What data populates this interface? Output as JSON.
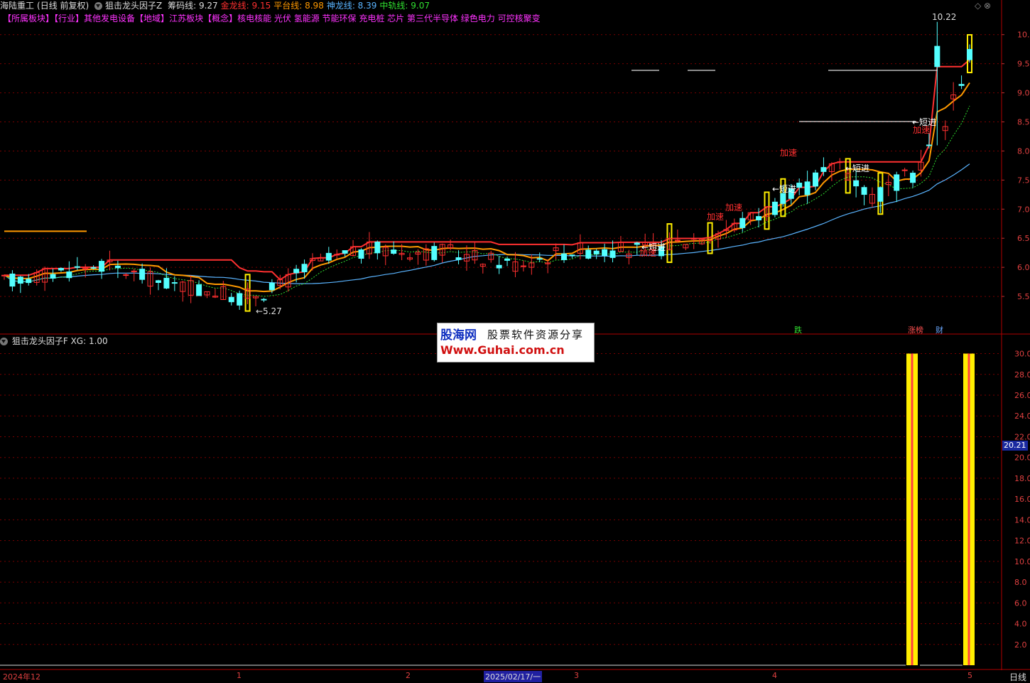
{
  "header": {
    "stock_name": "海陆重工",
    "period_mode": "(日线 前复权)",
    "indicator_name": "狙击龙头因子Z",
    "lines": [
      {
        "label": "筹码线:",
        "value": "9.27",
        "color": "#dddddd"
      },
      {
        "label": "金龙线:",
        "value": "9.15",
        "color": "#ff3030"
      },
      {
        "label": "平台线:",
        "value": "8.98",
        "color": "#ff9900"
      },
      {
        "label": "神龙线:",
        "value": "8.39",
        "color": "#5ab4ff"
      },
      {
        "label": "中轨线:",
        "value": "9.07",
        "color": "#30e030"
      }
    ]
  },
  "tags": {
    "sector_label": "【所属板块】",
    "industry_label": "【行业】",
    "industry": "其他发电设备",
    "region_label": "【地域】",
    "region": "江苏板块",
    "concept_label": "【概念】",
    "concepts": "核电核能 光伏 氢能源 节能环保 充电桩 芯片 第三代半导体 绿色电力 可控核聚变"
  },
  "price_axis": [
    "10.0",
    "9.5",
    "9.0",
    "8.5",
    "8.0",
    "7.5",
    "7.0",
    "6.5",
    "6.0",
    "5.5"
  ],
  "price_range": [
    5.0,
    10.4
  ],
  "annotations": {
    "high_label": "10.22",
    "low_label": "5.27",
    "short_entry": "←短进",
    "accelerate": "加速"
  },
  "sub_header": {
    "indicator_name": "狙击龙头因子F",
    "xg_label": "XG:",
    "xg_value": "1.00"
  },
  "sub_axis": [
    "30.0",
    "28.0",
    "26.0",
    "24.0",
    "22.0",
    "20.0",
    "18.0",
    "16.0",
    "14.0",
    "12.0",
    "10.0",
    "8.0",
    "6.0",
    "4.0",
    "2.0"
  ],
  "sub_current_value": "20.21",
  "markers": {
    "die": "跌",
    "zhangbang": "涨榜",
    "cai": "财"
  },
  "date_axis": [
    {
      "label": "2024年12",
      "highlight": false
    },
    {
      "label": "1",
      "highlight": false
    },
    {
      "label": "2",
      "highlight": false
    },
    {
      "label": "2025/02/17/一",
      "highlight": true
    },
    {
      "label": "3",
      "highlight": false
    },
    {
      "label": "4",
      "highlight": false
    },
    {
      "label": "5",
      "highlight": false
    }
  ],
  "period_label": "日线",
  "watermark": {
    "site_name": "股海网",
    "tagline": "股票软件资源分享",
    "url": "Www.Guhai.com.cn"
  },
  "colors": {
    "up": "#ff3030",
    "down": "#54ffff",
    "gold": "#ff3030",
    "platform": "#ff9900",
    "shenlong": "#5ab4ff",
    "mid": "#30e030",
    "grid": "#7a0000",
    "signal": "#ffee00"
  }
}
